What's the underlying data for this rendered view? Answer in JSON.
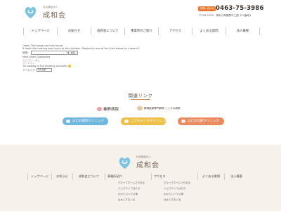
{
  "header": {
    "logo_sub": "社会福祉法人",
    "logo_name": "成和会",
    "tel_badge": "お問い合わせ",
    "tel_number": "0463-75-3986",
    "address": "〒259-1203　神奈川県秦野市三廻 127番地3"
  },
  "nav": {
    "items": [
      "トップページ",
      "お知らせ",
      "成和会について",
      "事業所のご紹介",
      "アクセス",
      "よくある質問",
      "法人概要"
    ]
  },
  "error": {
    "line1": "Oops! That page can't be found.",
    "line2": "It looks like nothing was found at this location. Maybe try one of the links below or a search?",
    "search_label": "検索：",
    "search_placeholder": "",
    "search_button": "検索",
    "most_used": "Most Used Categories",
    "category1": "カテゴリーなし",
    "category2": "ブーメラン",
    "emoji_text": "Try looking in the monthly archives.",
    "archive_label": "アーカイブ",
    "archive_select": "月を選択"
  },
  "related": {
    "title": "関連リンク",
    "hospital1": "秦野病院",
    "hospital2": "精神医療専門病院 こころの病院",
    "clinic1": "はたの病院クリニック",
    "clinic2": "こどもメンタルクリニック",
    "clinic3": "はたの北部クリニック"
  },
  "footer": {
    "logo_sub": "社会福祉法人",
    "logo_name": "成和会",
    "nav": [
      "トップページ",
      "お知らせ",
      "成和会について",
      "事業所紹介",
      "アクセス",
      "よくある質問",
      "法人概要"
    ],
    "sub_list_1": [
      "グループホームさやまる",
      "ジョブライフはたの",
      "わかたいハウス東",
      "はぁとすまいる"
    ],
    "sub_list_2": [
      "グループホームさやまる",
      "ジョブライフはたの",
      "わかたいハウス東",
      "はぁとすまいる"
    ]
  },
  "colors": {
    "accent": "#e8752a",
    "heart": "#7cc3df",
    "footer_bg": "#f7f1ec"
  }
}
